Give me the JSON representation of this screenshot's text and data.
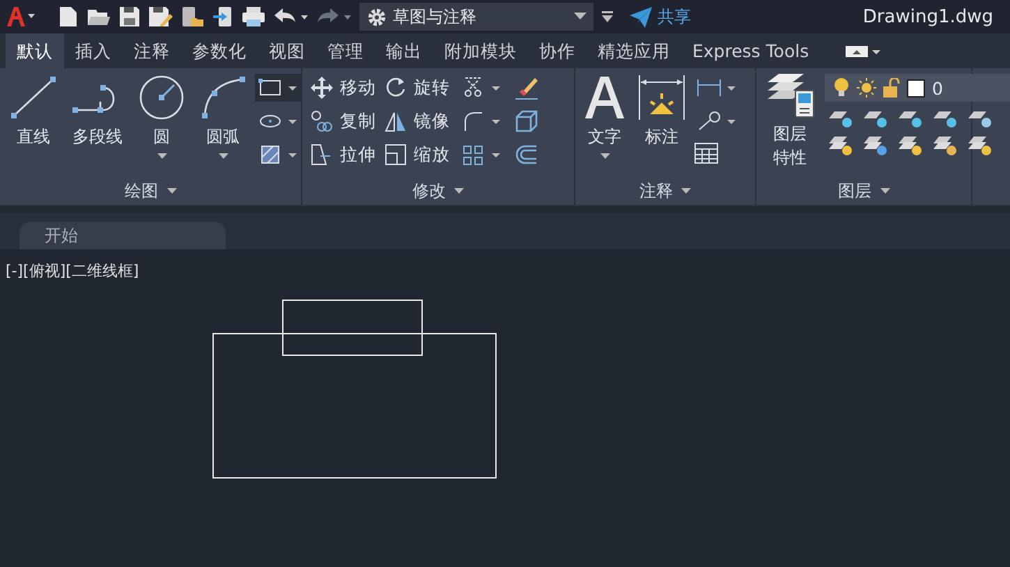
{
  "title_bar": {
    "workspace": "草图与注释",
    "share": "共享",
    "title": "Drawing1.dwg"
  },
  "tabs": [
    {
      "label": "默认",
      "selected": true
    },
    {
      "label": "插入",
      "selected": false
    },
    {
      "label": "注释",
      "selected": false
    },
    {
      "label": "参数化",
      "selected": false
    },
    {
      "label": "视图",
      "selected": false
    },
    {
      "label": "管理",
      "selected": false
    },
    {
      "label": "输出",
      "selected": false
    },
    {
      "label": "附加模块",
      "selected": false
    },
    {
      "label": "协作",
      "selected": false
    },
    {
      "label": "精选应用",
      "selected": false
    },
    {
      "label": "Express Tools",
      "selected": false
    }
  ],
  "panels": [
    {
      "title": "绘图",
      "tools": [
        "直线",
        "多段线",
        "圆",
        "圆弧"
      ]
    },
    {
      "title": "修改",
      "tools": [
        "移动",
        "复制",
        "拉伸",
        "旋转",
        "镜像",
        "缩放"
      ]
    },
    {
      "title": "注释",
      "tools": [
        "文字",
        "标注"
      ]
    },
    {
      "title": "图层",
      "tools": [
        "图层特性"
      ],
      "layer": "0"
    }
  ],
  "file_tabs": [
    {
      "label": "开始",
      "selected": true
    }
  ],
  "viewport_label": "[-][俯视][二维线框]"
}
